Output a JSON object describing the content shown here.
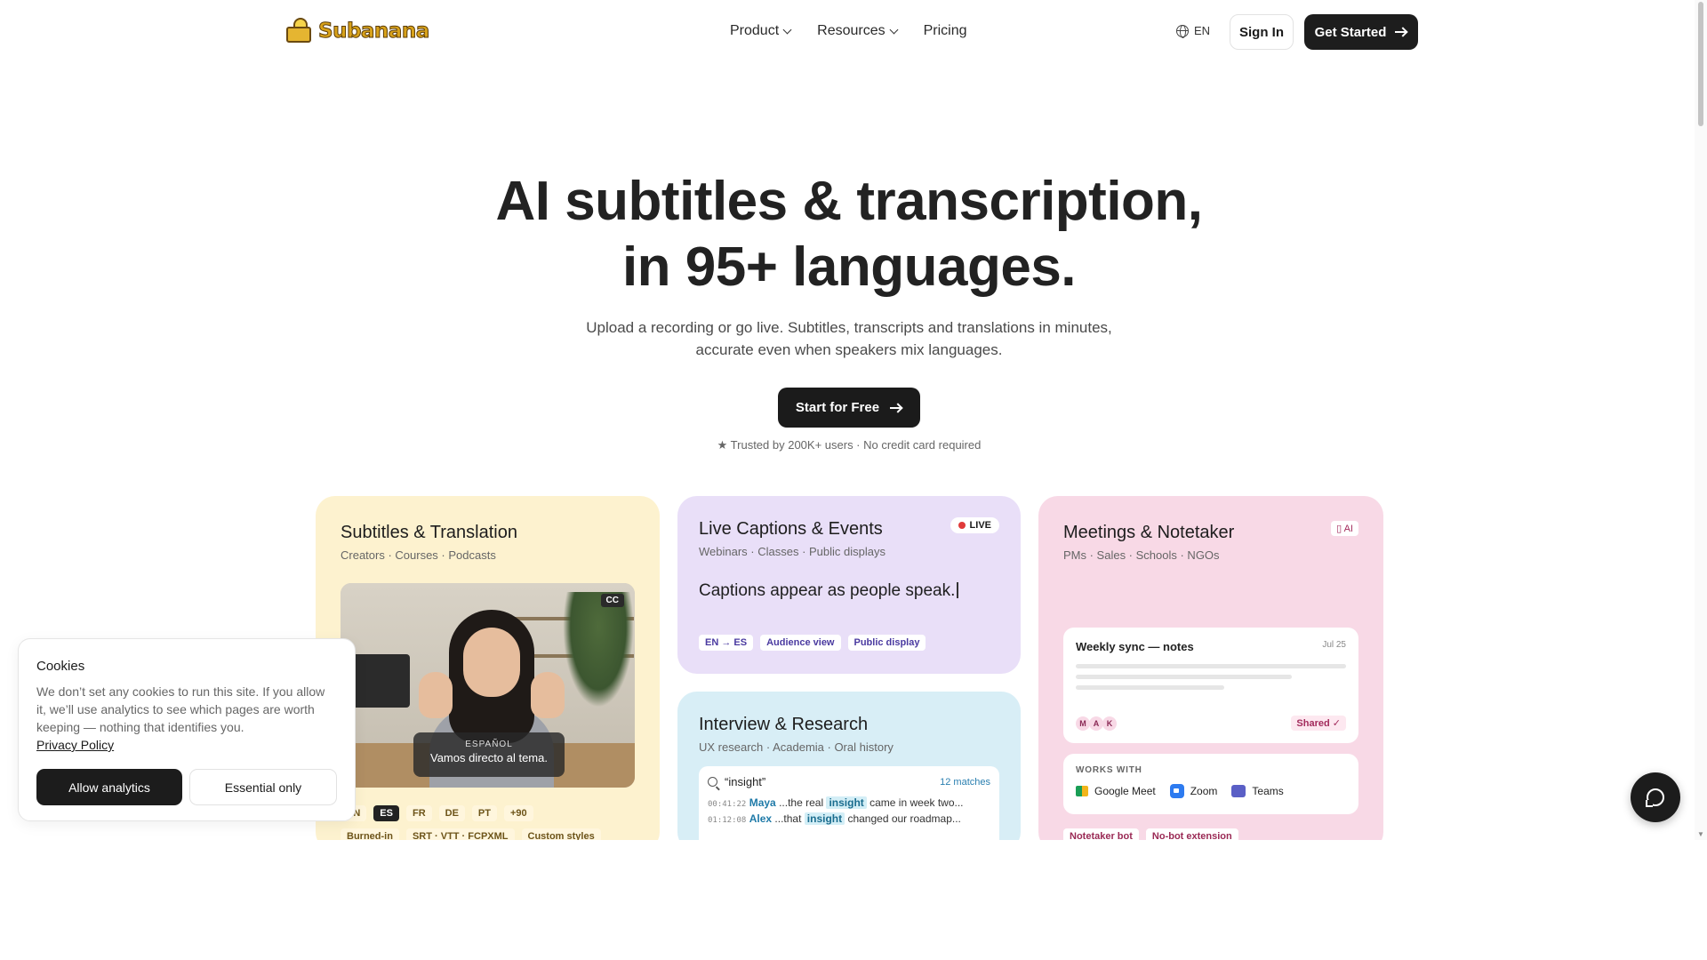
{
  "header": {
    "logo_text": "Subanana",
    "nav": [
      {
        "label": "Product",
        "dropdown": true
      },
      {
        "label": "Resources",
        "dropdown": true
      },
      {
        "label": "Pricing",
        "dropdown": false
      }
    ],
    "lang": "EN",
    "sign_in": "Sign In",
    "get_started": "Get Started"
  },
  "hero": {
    "title_line1": "AI subtitles & transcription,",
    "title_line2": "in 95+ languages.",
    "subtitle_line1": "Upload a recording or go live. Subtitles, transcripts and translations in minutes,",
    "subtitle_line2": "accurate even when speakers mix languages.",
    "cta": "Start for Free",
    "trusted": "★ Trusted by 200K+ users · No credit card required"
  },
  "cards": {
    "subtitles": {
      "title": "Subtitles & Translation",
      "tags": "Creators · Courses · Podcasts",
      "cc_badge": "CC",
      "caption_lang": "ESPAÑOL",
      "caption_text": "Vamos directo al tema.",
      "langs": [
        "EN",
        "ES",
        "FR",
        "DE",
        "PT",
        "+90"
      ],
      "features": [
        "Burned-in",
        "SRT · VTT · FCPXML",
        "Custom styles"
      ]
    },
    "live": {
      "title": "Live Captions & Events",
      "tags": "Webinars · Classes · Public displays",
      "badge": "LIVE",
      "caption": "Captions appear as people speak.",
      "chips": [
        "EN → ES",
        "Audience view",
        "Public display"
      ]
    },
    "interview": {
      "title": "Interview & Research",
      "tags": "UX research · Academia · Oral history",
      "search_query": "“insight”",
      "matches": "12 matches",
      "results": [
        {
          "time": "00:41:22",
          "who": "Maya",
          "before": "...the real",
          "hit": "insight",
          "after": "came in week two..."
        },
        {
          "time": "01:12:08",
          "who": "Alex",
          "before": "...that",
          "hit": "insight",
          "after": "changed our roadmap..."
        }
      ]
    },
    "meetings": {
      "title": "Meetings & Notetaker",
      "tags": "PMs · Sales · Schools · NGOs",
      "ai_badge": "AI",
      "notes_title": "Weekly sync — notes",
      "notes_date": "Jul 25",
      "avatars": [
        "M",
        "A",
        "K"
      ],
      "shared": "Shared ✓",
      "works_title": "WORKS WITH",
      "integrations": [
        "Google Meet",
        "Zoom",
        "Teams"
      ],
      "features": [
        "Notetaker bot",
        "No-bot extension"
      ]
    }
  },
  "cookies": {
    "title": "Cookies",
    "body": "We don’t set any cookies to run this site. If you allow it, we’ll use analytics to see which pages are worth keeping — nothing that identifies you.",
    "privacy_link": "Privacy Policy",
    "allow": "Allow analytics",
    "essential": "Essential only"
  }
}
